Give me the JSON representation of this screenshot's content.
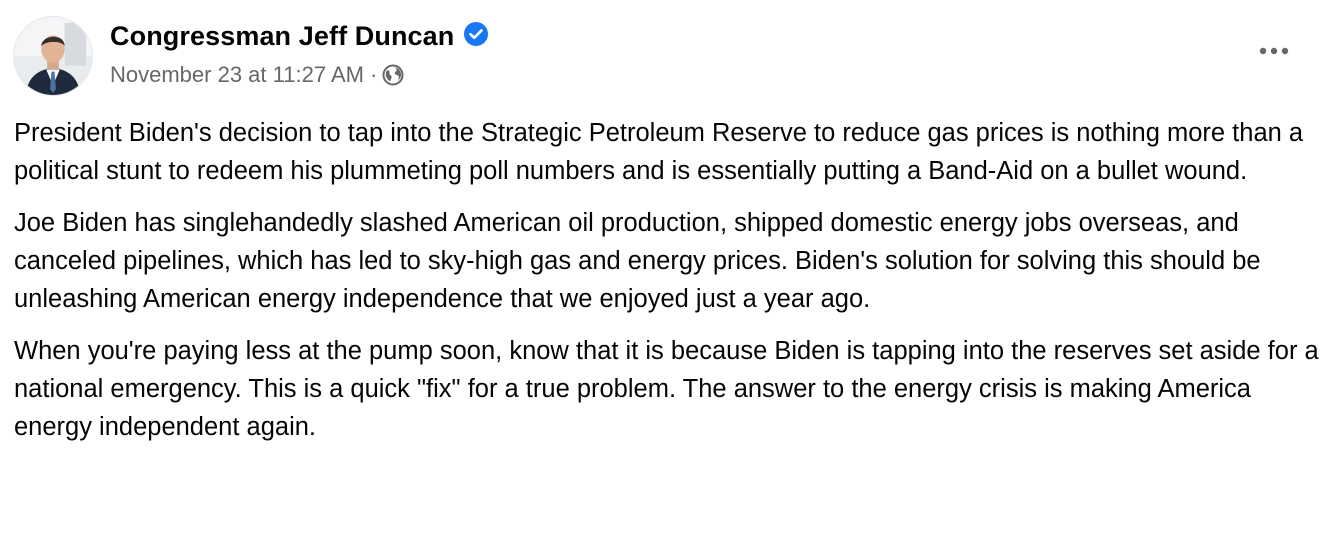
{
  "post": {
    "author": "Congressman Jeff Duncan",
    "verified_icon": "verified-badge-icon",
    "timestamp": "November 23 at 11:27 AM",
    "separator": "·",
    "audience_icon": "globe-icon",
    "more_icon": "more-options-icon",
    "paragraphs": [
      "President Biden's decision to tap into the Strategic Petroleum Reserve to reduce gas prices is nothing more than a political stunt to redeem his plummeting poll numbers and is essentially putting a Band-Aid on a bullet wound.",
      "Joe Biden has singlehandedly slashed American oil production, shipped domestic energy jobs overseas, and canceled pipelines, which has led to sky-high gas and energy prices. Biden's solution for solving this should be unleashing American energy independence that we enjoyed just a year ago.",
      "When you're paying less at the pump soon, know that it is because Biden is tapping into the reserves set aside for a national emergency. This is a quick \"fix\" for a true problem. The answer to the energy crisis is making America energy independent again."
    ]
  },
  "colors": {
    "text_primary": "#050505",
    "text_secondary": "#65676b",
    "verified_blue": "#1877f2",
    "background": "#ffffff"
  }
}
